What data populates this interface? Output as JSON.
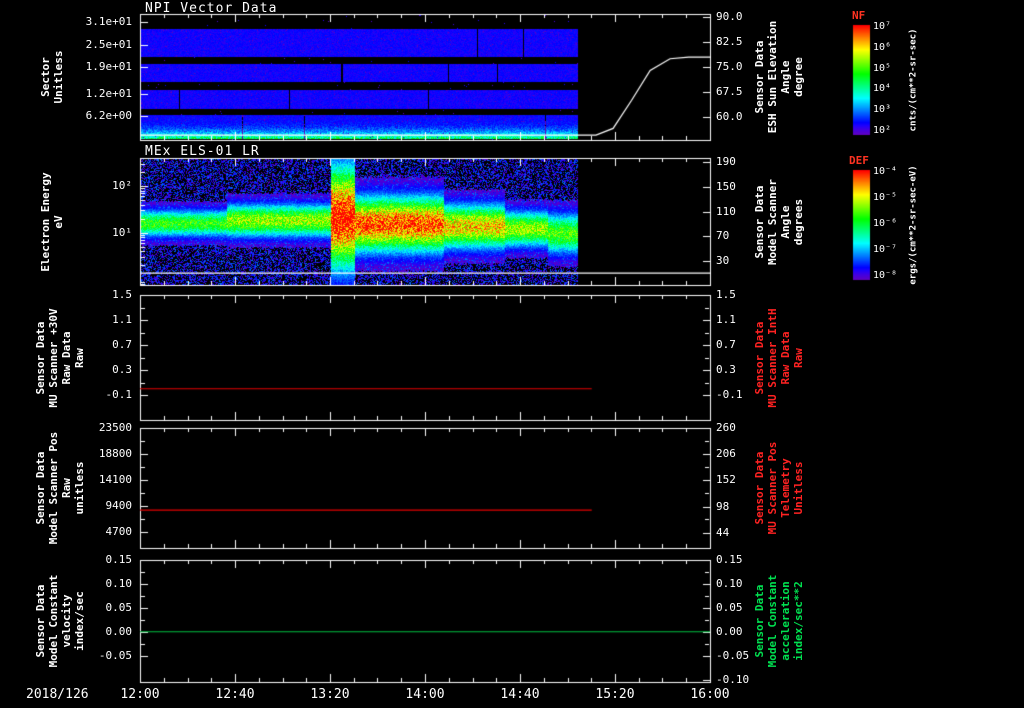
{
  "page": {
    "background": "#000000"
  },
  "xaxis": {
    "date_label": "2018/126",
    "range": [
      12.0,
      16.0
    ],
    "ticks": [
      {
        "label": "12:00",
        "t": 12.0
      },
      {
        "label": "12:40",
        "t": 12.6667
      },
      {
        "label": "13:20",
        "t": 13.3333
      },
      {
        "label": "14:00",
        "t": 14.0
      },
      {
        "label": "14:40",
        "t": 14.6667
      },
      {
        "label": "15:20",
        "t": 15.3333
      },
      {
        "label": "16:00",
        "t": 16.0
      }
    ],
    "minor_step_hours": 0.1667
  },
  "chart_data": [
    {
      "type": "heatmap",
      "title": "NPI Vector Data",
      "left_label_lines": [
        "Sector",
        "Unitless"
      ],
      "left_ticks": [
        {
          "label": "3.1e+01",
          "value": 31
        },
        {
          "label": "2.5e+01",
          "value": 25
        },
        {
          "label": "1.9e+01",
          "value": 19
        },
        {
          "label": "1.2e+01",
          "value": 12
        },
        {
          "label": "6.2e+00",
          "value": 6.2
        }
      ],
      "yrange": [
        0,
        33
      ],
      "right_axis": {
        "lines": [
          "Sensor Data",
          "ESH Sun Elevation",
          "Angle",
          "degree"
        ],
        "color": "#ffffff",
        "ticks": [
          {
            "label": "90.0",
            "value": 90
          },
          {
            "label": "82.5",
            "value": 82.5
          },
          {
            "label": "75.0",
            "value": 75
          },
          {
            "label": "67.5",
            "value": 67.5
          },
          {
            "label": "60.0",
            "value": 60
          }
        ],
        "range": [
          53,
          91
        ]
      },
      "data_end_time": 15.08,
      "bands": [
        {
          "y0": 0.11,
          "y1": 0.335,
          "v": 0.13
        },
        {
          "y0": 0.39,
          "y1": 0.53,
          "v": 0.13
        },
        {
          "y0": 0.6,
          "y1": 0.745,
          "v": 0.13
        },
        {
          "y0": 0.8,
          "y1": 0.985,
          "v": 0.14,
          "grad_to": 0.5
        }
      ],
      "series": [
        {
          "name": "ESH Sun Elevation Angle",
          "color": "#ffffff",
          "axis": "right",
          "points": [
            [
              12.0,
              54.5
            ],
            [
              15.2,
              54.5
            ],
            [
              15.32,
              56.5
            ],
            [
              15.45,
              65
            ],
            [
              15.58,
              74
            ],
            [
              15.72,
              77.5
            ],
            [
              15.85,
              78
            ],
            [
              16.0,
              78
            ]
          ]
        }
      ],
      "colorbar": {
        "title": "NF",
        "ticks": [
          "10⁷",
          "10⁶",
          "10⁵",
          "10⁴",
          "10³",
          "10²"
        ],
        "unit": "cnts/(cm**2-sr-sec)"
      }
    },
    {
      "type": "heatmap",
      "title": "MEx ELS-01 LR",
      "left_label_lines": [
        "Electron Energy",
        "eV"
      ],
      "left_ticks": [
        {
          "label": "10²",
          "value": 100
        },
        {
          "label": "10¹",
          "value": 10
        }
      ],
      "log_y": true,
      "yrange_log": [
        -0.12,
        2.6
      ],
      "right_axis": {
        "lines": [
          "Sensor Data",
          "Model Scanner",
          "Angle",
          "degrees"
        ],
        "color": "#ffffff",
        "ticks": [
          {
            "label": "190",
            "value": 190
          },
          {
            "label": "150",
            "value": 150
          },
          {
            "label": "110",
            "value": 110
          },
          {
            "label": "70",
            "value": 70
          },
          {
            "label": "30",
            "value": 30
          }
        ],
        "range": [
          -8,
          196
        ]
      },
      "data_end_time": 15.08,
      "noise_fill": 0.5,
      "features": [
        {
          "t0": 12.0,
          "t1": 12.6,
          "center_log": 1.22,
          "sigma": 0.2,
          "amp": 0.58
        },
        {
          "t0": 12.6,
          "t1": 13.33,
          "center_log": 1.28,
          "sigma": 0.24,
          "amp": 0.68
        },
        {
          "t0": 13.33,
          "t1": 13.5,
          "center_log": 1.35,
          "sigma": 0.75,
          "amp": 1.0
        },
        {
          "t0": 13.5,
          "t1": 14.12,
          "center_log": 1.2,
          "sigma": 0.4,
          "amp": 0.93
        },
        {
          "t0": 14.12,
          "t1": 14.55,
          "center_log": 1.15,
          "sigma": 0.32,
          "amp": 0.8
        },
        {
          "t0": 14.55,
          "t1": 14.85,
          "center_log": 1.1,
          "sigma": 0.26,
          "amp": 0.68
        },
        {
          "t0": 14.85,
          "t1": 15.08,
          "center_log": 1.0,
          "sigma": 0.3,
          "amp": 0.6
        }
      ],
      "series": [
        {
          "name": "Model Scanner Angle",
          "color": "#ffffff",
          "axis": "right",
          "points": [
            [
              12.0,
              11
            ],
            [
              16.0,
              11
            ]
          ]
        }
      ],
      "colorbar": {
        "title": "DEF",
        "ticks": [
          "10⁻⁴",
          "10⁻⁵",
          "10⁻⁶",
          "10⁻⁷",
          "10⁻⁸"
        ],
        "unit": "ergs/(cm**2-sr-sec-eV)"
      }
    },
    {
      "type": "line",
      "left_label_lines": [
        "Sensor Data",
        "MU Scanner +30V",
        "Raw Data",
        "Raw"
      ],
      "left_ticks": [
        {
          "label": "1.5",
          "value": 1.5
        },
        {
          "label": "1.1",
          "value": 1.1
        },
        {
          "label": "0.7",
          "value": 0.7
        },
        {
          "label": "0.3",
          "value": 0.3
        },
        {
          "label": "-0.1",
          "value": -0.1
        }
      ],
      "yrange": [
        -0.5,
        1.5
      ],
      "right_axis": {
        "lines": [
          "Sensor Data",
          "MU Scanner IntH",
          "Raw Data",
          "Raw"
        ],
        "color": "#ff2222",
        "ticks": [
          {
            "label": "1.5",
            "value": 1.5
          },
          {
            "label": "1.1",
            "value": 1.1
          },
          {
            "label": "0.7",
            "value": 0.7
          },
          {
            "label": "0.3",
            "value": 0.3
          },
          {
            "label": "-0.1",
            "value": -0.1
          }
        ],
        "range": [
          -0.5,
          1.5
        ]
      },
      "series": [
        {
          "name": "MU Scanner +30V Raw",
          "color": "#e60000",
          "axis": "left",
          "points": [
            [
              12.0,
              0.0
            ],
            [
              15.17,
              0.0
            ]
          ]
        }
      ]
    },
    {
      "type": "line",
      "left_label_lines": [
        "Sensor Data",
        "Model Scanner Pos",
        "Raw",
        "unitless"
      ],
      "left_ticks": [
        {
          "label": "23500",
          "value": 23500
        },
        {
          "label": "18800",
          "value": 18800
        },
        {
          "label": "14100",
          "value": 14100
        },
        {
          "label": "9400",
          "value": 9400
        },
        {
          "label": "4700",
          "value": 4700
        }
      ],
      "yrange": [
        1900,
        23500
      ],
      "right_axis": {
        "lines": [
          "Sensor Data",
          "MU Scanner Pos",
          "Telemetry",
          "Unitless"
        ],
        "color": "#ff2222",
        "ticks": [
          {
            "label": "260",
            "value": 260
          },
          {
            "label": "206",
            "value": 206
          },
          {
            "label": "152",
            "value": 152
          },
          {
            "label": "98",
            "value": 98
          },
          {
            "label": "44",
            "value": 44
          }
        ],
        "range": [
          13,
          260
        ]
      },
      "series": [
        {
          "name": "Model Scanner Pos Raw",
          "color": "#e60000",
          "axis": "left",
          "points": [
            [
              12.0,
              8700
            ],
            [
              15.17,
              8700
            ]
          ]
        }
      ]
    },
    {
      "type": "line",
      "left_label_lines": [
        "Sensor Data",
        "Model Constant",
        "velocity",
        "index/sec"
      ],
      "left_ticks": [
        {
          "label": "0.15",
          "value": 0.15
        },
        {
          "label": "0.10",
          "value": 0.1
        },
        {
          "label": "0.05",
          "value": 0.05
        },
        {
          "label": "0.00",
          "value": 0.0
        },
        {
          "label": "-0.05",
          "value": -0.05
        }
      ],
      "yrange": [
        -0.105,
        0.15
      ],
      "right_axis": {
        "lines": [
          "Sensor Data",
          "Model Constant",
          "acceleration",
          "index/sec**2"
        ],
        "color": "#00e050",
        "ticks": [
          {
            "label": "0.15",
            "value": 0.15
          },
          {
            "label": "0.10",
            "value": 0.1
          },
          {
            "label": "0.05",
            "value": 0.05
          },
          {
            "label": "0.00",
            "value": 0.0
          },
          {
            "label": "-0.05",
            "value": -0.05
          },
          {
            "label": "-0.10",
            "value": -0.1
          }
        ],
        "range": [
          -0.105,
          0.15
        ]
      },
      "series": [
        {
          "name": "Model Constant velocity",
          "color": "#00c040",
          "axis": "left",
          "points": [
            [
              12.0,
              0.0
            ],
            [
              16.0,
              0.0
            ]
          ]
        }
      ]
    }
  ]
}
